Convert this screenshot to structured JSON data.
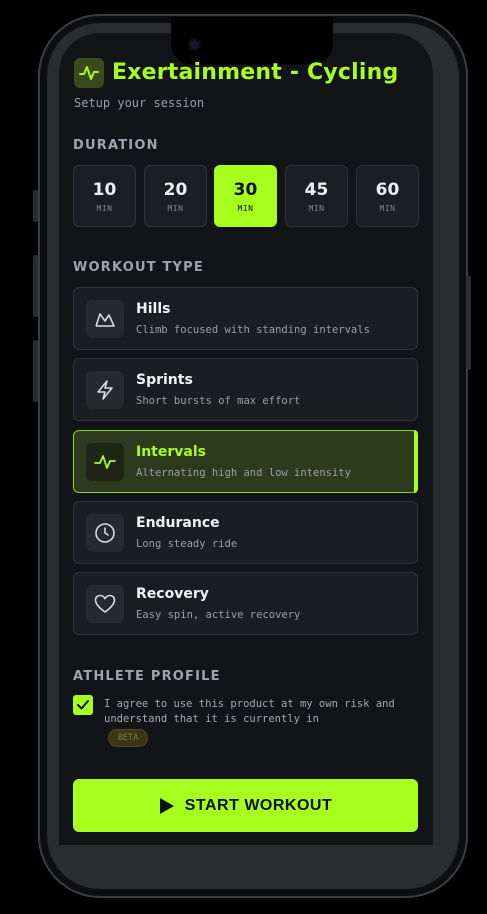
{
  "header": {
    "title": "Exertainment - Cycling",
    "subtitle": "Setup your session",
    "icon": "pulse-icon"
  },
  "duration": {
    "label": "DURATION",
    "selected": "30",
    "options": [
      {
        "value": "10",
        "unit": "MIN"
      },
      {
        "value": "20",
        "unit": "MIN"
      },
      {
        "value": "30",
        "unit": "MIN"
      },
      {
        "value": "45",
        "unit": "MIN"
      },
      {
        "value": "60",
        "unit": "MIN"
      }
    ]
  },
  "workout": {
    "label": "WORKOUT TYPE",
    "selected": "Intervals",
    "types": [
      {
        "name": "Hills",
        "desc": "Climb focused with standing intervals",
        "icon": "mountain-icon"
      },
      {
        "name": "Sprints",
        "desc": "Short bursts of max effort",
        "icon": "lightning-icon"
      },
      {
        "name": "Intervals",
        "desc": "Alternating high and low intensity",
        "icon": "pulse-icon"
      },
      {
        "name": "Endurance",
        "desc": "Long steady ride",
        "icon": "clock-icon"
      },
      {
        "name": "Recovery",
        "desc": "Easy spin, active recovery",
        "icon": "heart-icon"
      }
    ]
  },
  "athlete": {
    "label": "ATHLETE PROFILE",
    "agree_text": "I agree to use this product at my own risk and understand that it is currently in",
    "agree_checked": true,
    "badge": "BETA"
  },
  "start_button": {
    "label": "START WORKOUT",
    "icon": "play-icon"
  },
  "colors": {
    "accent": "#a6ff1e",
    "background": "#131417",
    "card": "#1b1d22"
  }
}
